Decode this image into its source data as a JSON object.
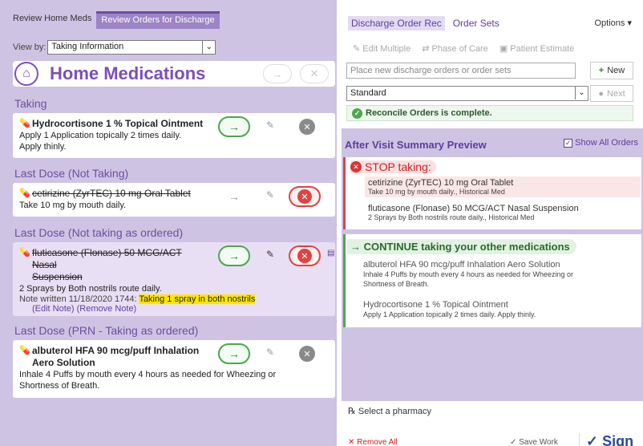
{
  "left": {
    "tabs": [
      "Review Home Meds",
      "Review Orders for Discharge"
    ],
    "view_by_label": "View by:",
    "view_by_value": "Taking Information",
    "title": "Home Medications",
    "sections": [
      {
        "heading": "Taking",
        "med": {
          "name": "Hydrocortisone 1 % Topical Ointment",
          "sig": [
            "Apply 1 Application topically 2 times daily.",
            "Apply thinly."
          ]
        }
      },
      {
        "heading": "Last Dose (Not Taking)",
        "med": {
          "name": "cetirizine (ZyrTEC) 10 mg Oral Tablet",
          "sig": [
            "Take 10 mg by mouth daily."
          ]
        }
      },
      {
        "heading": "Last Dose (Not taking as ordered)",
        "med": {
          "name_line1": "fluticasone (Flonase) 50 MCG/ACT Nasal",
          "name_line2": "Suspension",
          "sig": [
            "2 Sprays by Both nostrils route daily."
          ],
          "note_prefix": "Note written 11/18/2020 1744:",
          "note_text": "Taking 1 spray in both nostrils",
          "edit_note": "(Edit Note)",
          "remove_note": "(Remove Note)"
        }
      },
      {
        "heading": "Last Dose (PRN - Taking as ordered)",
        "med": {
          "name_line1": "albuterol HFA 90 mcg/puff Inhalation",
          "name_line2": "Aero Solution",
          "sig": [
            "Inhale 4 Puffs by mouth every 4 hours as needed for Wheezing or",
            "Shortness of Breath."
          ]
        }
      }
    ]
  },
  "right": {
    "tabs": [
      "Discharge Order Rec",
      "Order Sets"
    ],
    "options": "Options ▾",
    "tools": [
      "Edit Multiple",
      "Phase of Care",
      "Patient Estimate"
    ],
    "new_order_placeholder": "Place new discharge orders or order sets",
    "new_label": "New",
    "standard": "Standard",
    "next_label": "Next",
    "reconcile_msg": "Reconcile Orders is complete.",
    "avs_title": "After Visit Summary Preview",
    "show_all": "Show All Orders",
    "stop_heading": "STOP taking:",
    "stop_items": [
      {
        "name": "cetirizine (ZyrTEC) 10 mg Oral Tablet",
        "sig": "Take 10 mg by mouth daily., Historical Med"
      },
      {
        "name": "fluticasone (Flonase) 50 MCG/ACT Nasal Suspension",
        "sig": "2 Sprays by Both nostrils route daily., Historical Med"
      }
    ],
    "continue_heading": "CONTINUE taking your other medications",
    "continue_items": [
      {
        "name": "albuterol HFA 90 mcg/puff Inhalation Aero Solution",
        "sig1": "Inhale 4 Puffs by mouth every 4 hours as needed for Wheezing or",
        "sig2": "Shortness of Breath."
      },
      {
        "name": "Hydrocortisone 1 % Topical Ointment",
        "sig1": "Apply 1 Application topically 2 times daily. Apply thinly.",
        "sig2": ""
      }
    ],
    "pharmacy": "Select a pharmacy",
    "remove_all": "Remove All",
    "save_work": "Save Work",
    "sign": "Sign"
  },
  "colors": {
    "accent": "#7b4fb8",
    "panel": "#cfc3e3",
    "stop": "#d44444",
    "continue": "#4aa84a"
  }
}
